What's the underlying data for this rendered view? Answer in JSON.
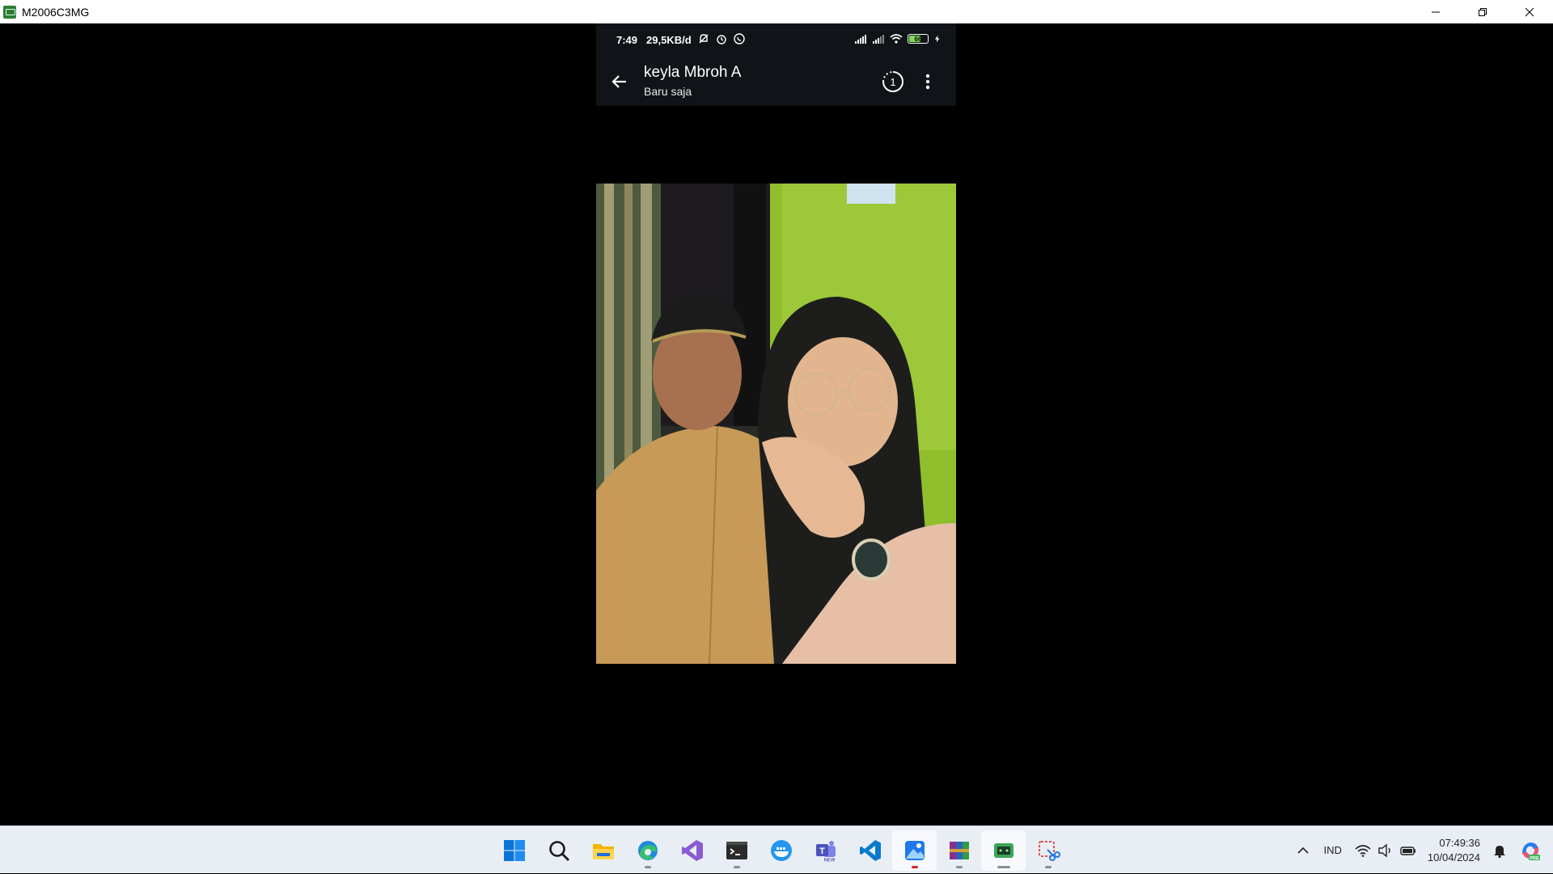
{
  "window": {
    "title": "M2006C3MG",
    "controls": [
      "minimize-icon",
      "restore-icon",
      "close-icon"
    ]
  },
  "phone": {
    "status_bar": {
      "time": "7:49",
      "speed": "29,5KB/d",
      "left_icons": [
        "mute-icon",
        "alarm-icon",
        "whatsapp-icon"
      ],
      "right_icons": [
        "signal-icon",
        "signal-icon",
        "wifi-icon",
        "battery-icon",
        "charging-icon"
      ],
      "battery_level": "66",
      "battery_fraction": 0.66,
      "battery_color": "#7ed957"
    },
    "app_bar": {
      "contact_name": "keyla Mbroh A",
      "subtitle": "Baru saja",
      "icons": [
        "back-arrow-icon",
        "view-once-timer-icon",
        "more-vert-icon"
      ],
      "timer_label": "1"
    },
    "photo": {
      "alt": "status-photo"
    }
  },
  "taskbar": {
    "apps": [
      {
        "name": "start-button",
        "icon": "windows-icon"
      },
      {
        "name": "search-button",
        "icon": "search-icon"
      },
      {
        "name": "file-explorer",
        "icon": "folder-icon"
      },
      {
        "name": "edge-browser",
        "icon": "edge-icon",
        "running": true
      },
      {
        "name": "visual-studio",
        "icon": "visual-studio-icon"
      },
      {
        "name": "terminal",
        "icon": "terminal-icon",
        "running": true
      },
      {
        "name": "docker",
        "icon": "docker-icon"
      },
      {
        "name": "teams",
        "icon": "teams-icon",
        "badge": "NEW"
      },
      {
        "name": "vscode",
        "icon": "vscode-icon"
      },
      {
        "name": "photos",
        "icon": "photos-icon",
        "active": true,
        "notify": true
      },
      {
        "name": "winrar",
        "icon": "winrar-icon",
        "running": true
      },
      {
        "name": "scrcpy",
        "icon": "scrcpy-icon",
        "active": true,
        "running": true
      },
      {
        "name": "snipping-tool",
        "icon": "snipping-icon",
        "running": true
      }
    ],
    "tray": {
      "chevron": "chevron-up-icon",
      "language": "IND",
      "icons": [
        "wifi-icon",
        "volume-icon",
        "battery-icon"
      ],
      "time": "07:49:36",
      "date": "10/04/2024",
      "notifications": "bell-icon",
      "copilot": "copilot-icon",
      "copilot_badge": "PRE"
    }
  },
  "colors": {
    "titlebar_bg": "#ffffff",
    "phone_bar_bg": "#101418",
    "taskbar_bg": "#e9eef5",
    "accent_red": "#d62828"
  }
}
